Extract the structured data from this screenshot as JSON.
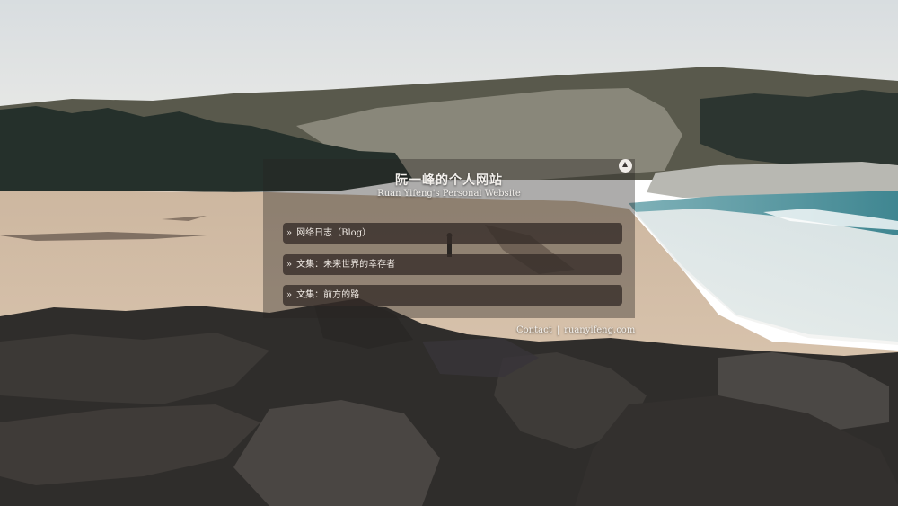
{
  "site": {
    "title": "阮一峰的个人网站",
    "subtitle": "Ruan Yifeng's Personal Website"
  },
  "menu": {
    "items": [
      {
        "chevron": "»",
        "label": "网络日志（Blog）"
      },
      {
        "chevron": "»",
        "label": "文集：未来世界的幸存者"
      },
      {
        "chevron": "»",
        "label": "文集：前方的路"
      }
    ]
  },
  "footer": {
    "contact_label": "Contact",
    "separator": "|",
    "domain": "ruanyifeng.com"
  },
  "icons": {
    "scroll_up": "triangle-up-circle-icon"
  },
  "colors": {
    "panel_overlay": "#2a2422",
    "menu_item_bg": "#342c28",
    "text": "#f3f0ec",
    "sea": "#4d8e98",
    "sand": "#d8c4ad"
  }
}
